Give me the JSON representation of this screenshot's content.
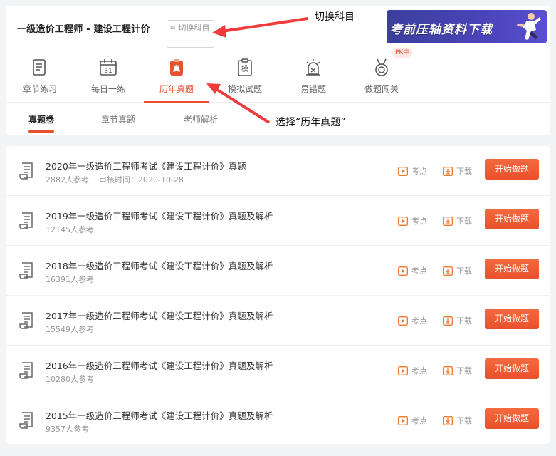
{
  "header": {
    "subject_title": "一级造价工程师 - 建设工程计价",
    "switch_label": "切换科目",
    "banner_text": "考前压轴资料下载"
  },
  "annotations": {
    "switch_note": "切换科目",
    "select_note": "选择“历年真题”",
    "arrow_color": "#f03c3c"
  },
  "tabs": [
    {
      "label": "章节练习",
      "icon": "chapter-practice-icon"
    },
    {
      "label": "每日一练",
      "icon": "calendar-icon",
      "icon_text": "31"
    },
    {
      "label": "历年真题",
      "icon": "past-exam-icon",
      "icon_text": "真",
      "active": true
    },
    {
      "label": "模拟试题",
      "icon": "mock-exam-icon",
      "icon_text": "模"
    },
    {
      "label": "易错题",
      "icon": "alarm-icon"
    },
    {
      "label": "做题闯关",
      "icon": "medal-icon"
    }
  ],
  "pk_badge": "PK中",
  "sub_tabs": [
    {
      "label": "真题卷",
      "active": true
    },
    {
      "label": "章节真题"
    },
    {
      "label": "老师解析"
    }
  ],
  "list": {
    "kaodian_label": "考点",
    "download_label": "下载",
    "start_label": "开始做题",
    "items": [
      {
        "title": "2020年一级造价工程师考试《建设工程计价》真题",
        "participants": "2882人参考",
        "audit": "审核时间：2020-10-28"
      },
      {
        "title": "2019年一级造价工程师考试《建设工程计价》真题及解析",
        "participants": "12145人参考"
      },
      {
        "title": "2018年一级造价工程师考试《建设工程计价》真题及解析",
        "participants": "16391人参考"
      },
      {
        "title": "2017年一级造价工程师考试《建设工程计价》真题及解析",
        "participants": "15549人参考"
      },
      {
        "title": "2016年一级造价工程师考试《建设工程计价》真题及解析",
        "participants": "10280人参考"
      },
      {
        "title": "2015年一级造价工程师考试《建设工程计价》真题及解析",
        "participants": "9357人参考"
      }
    ]
  },
  "colors": {
    "accent": "#e8502f",
    "banner": "#4a44b8"
  }
}
